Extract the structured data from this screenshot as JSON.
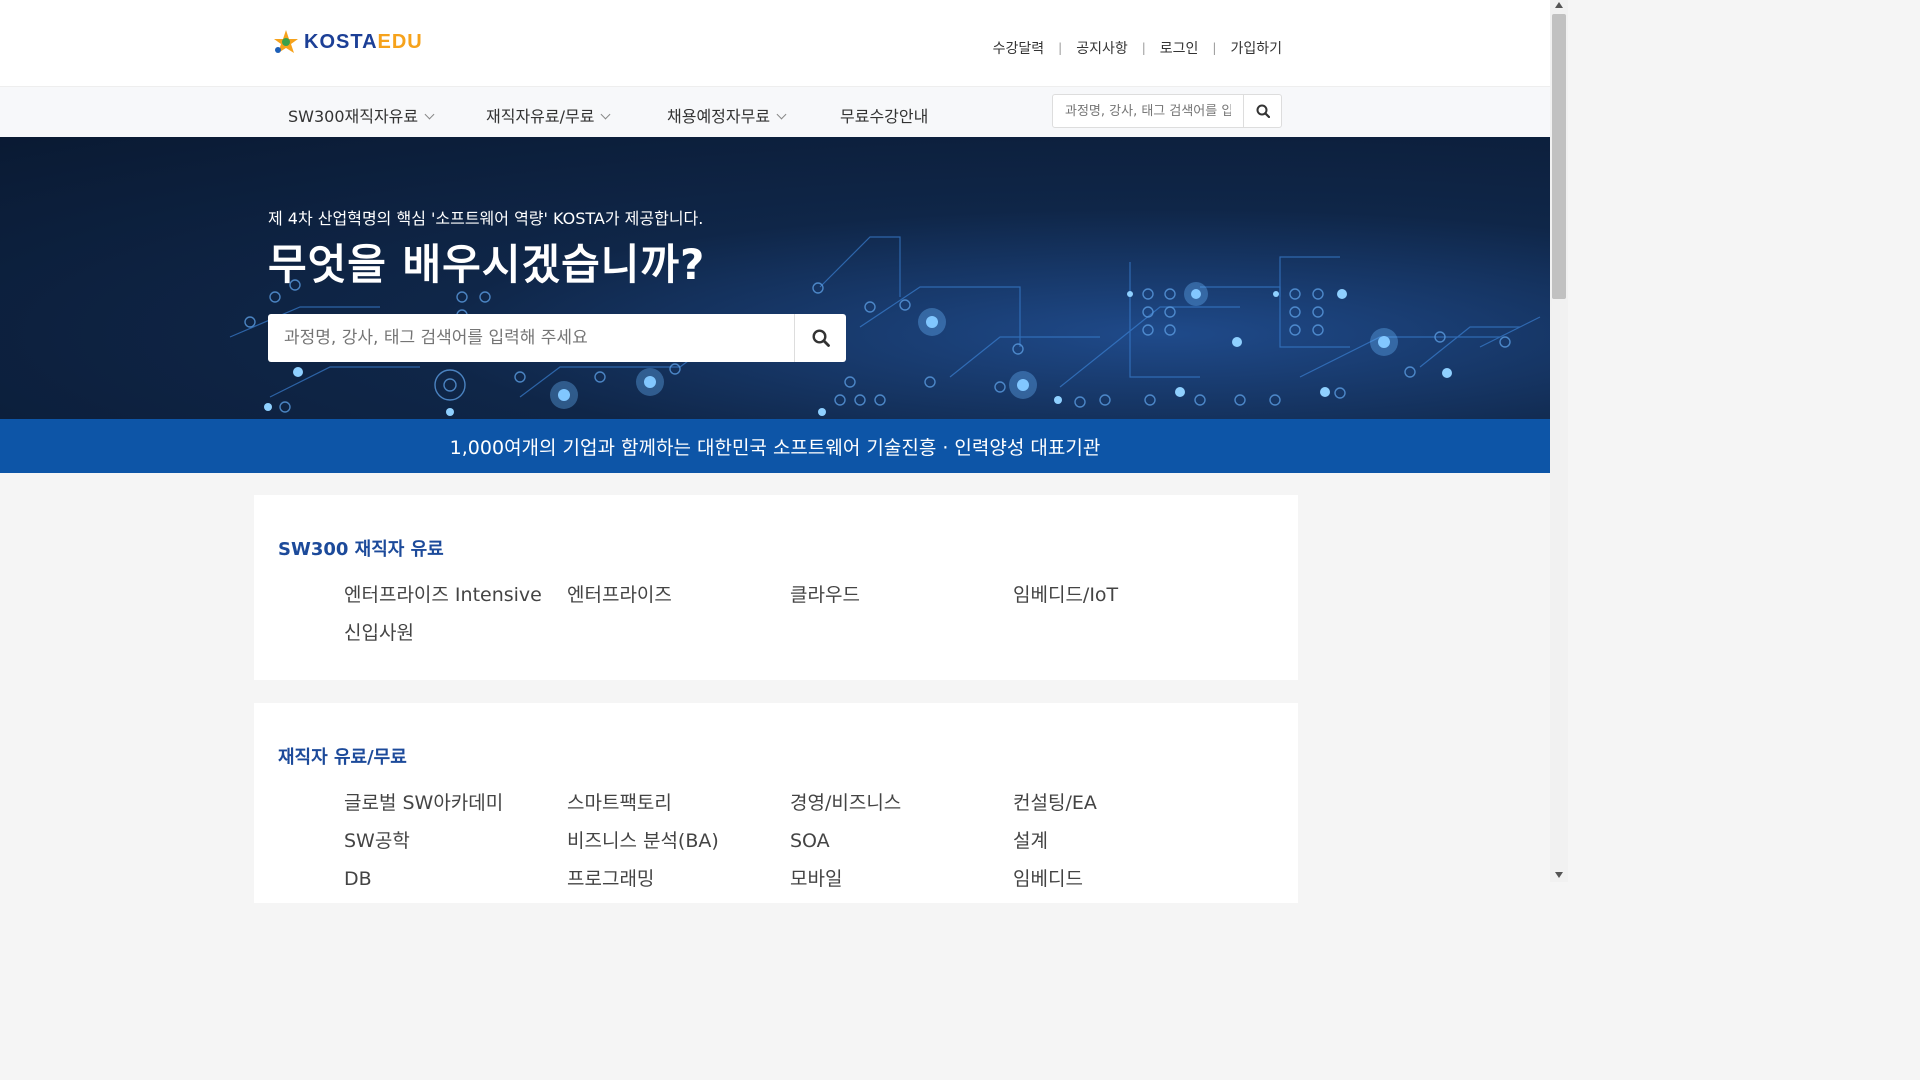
{
  "header": {
    "logo_text_main": "KOSTA",
    "logo_text_edu": "EDU",
    "util_links": [
      "수강달력",
      "공지사항",
      "로그인",
      "가입하기"
    ]
  },
  "nav": {
    "items": [
      {
        "label": "SW300재직자유료",
        "has_dropdown": true
      },
      {
        "label": "재직자유료/무료",
        "has_dropdown": true
      },
      {
        "label": "채용예정자무료",
        "has_dropdown": true
      },
      {
        "label": "무료수강안내",
        "has_dropdown": false
      }
    ],
    "search_placeholder": "과정명, 강사, 태그 검색어를 입력해 주세요"
  },
  "hero": {
    "subtitle": "제 4차 산업혁명의 핵심 '소프트웨어 역량' KOSTA가 제공합니다.",
    "title": "무엇을 배우시겠습니까?",
    "search_placeholder": "과정명, 강사, 태그 검색어를 입력해 주세요"
  },
  "banner": {
    "text": "1,000여개의 기업과 함께하는 대한민국 소프트웨어 기술진흥 · 인력양성 대표기관"
  },
  "sections": [
    {
      "title": "SW300 재직자 유료",
      "items": [
        "엔터프라이즈 Intensive",
        "엔터프라이즈",
        "클라우드",
        "임베디드/IoT",
        "신입사원"
      ]
    },
    {
      "title": "재직자 유료/무료",
      "items": [
        "글로벌 SW아카데미",
        "스마트팩토리",
        "경영/비즈니스",
        "컨설팅/EA",
        "SW공학",
        "비즈니스 분석(BA)",
        "SOA",
        "설계",
        "DB",
        "프로그래밍",
        "모바일",
        "임베디드"
      ]
    }
  ],
  "colors": {
    "brand_blue": "#1c4a9a",
    "banner_blue": "#0d55a7",
    "logo_orange": "#f6a21b"
  }
}
